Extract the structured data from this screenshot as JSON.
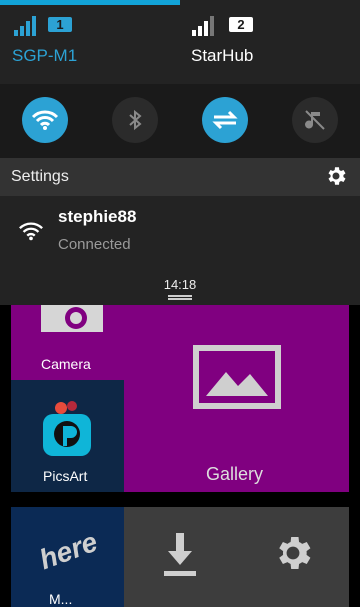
{
  "status": {
    "sim1": {
      "carrier": "SGP-M1",
      "sim_number": "1",
      "color": "#2ca2d4"
    },
    "sim2": {
      "carrier": "StarHub",
      "sim_number": "2",
      "color": "#ffffff"
    }
  },
  "quick_toggles": [
    {
      "name": "wifi",
      "icon": "wifi-icon",
      "state": "on"
    },
    {
      "name": "bluetooth",
      "icon": "bluetooth-icon",
      "state": "off"
    },
    {
      "name": "mobile-data",
      "icon": "data-transfer-icon",
      "state": "on"
    },
    {
      "name": "sound",
      "icon": "mute-icon",
      "state": "off"
    }
  ],
  "settings_row": {
    "label": "Settings",
    "icon": "gear-icon"
  },
  "notification": {
    "ssid": "stephie88",
    "status": "Connected",
    "icon": "wifi-icon"
  },
  "clock": "14:18",
  "tiles": {
    "camera": "Camera",
    "gallery": "Gallery",
    "picsart": "PicsArt",
    "here": "M..."
  },
  "colors": {
    "accent": "#2ca2d4",
    "tile_purple": "#800080",
    "tile_blue": "#0b2a55",
    "tile_gray": "#3d3d3d"
  }
}
